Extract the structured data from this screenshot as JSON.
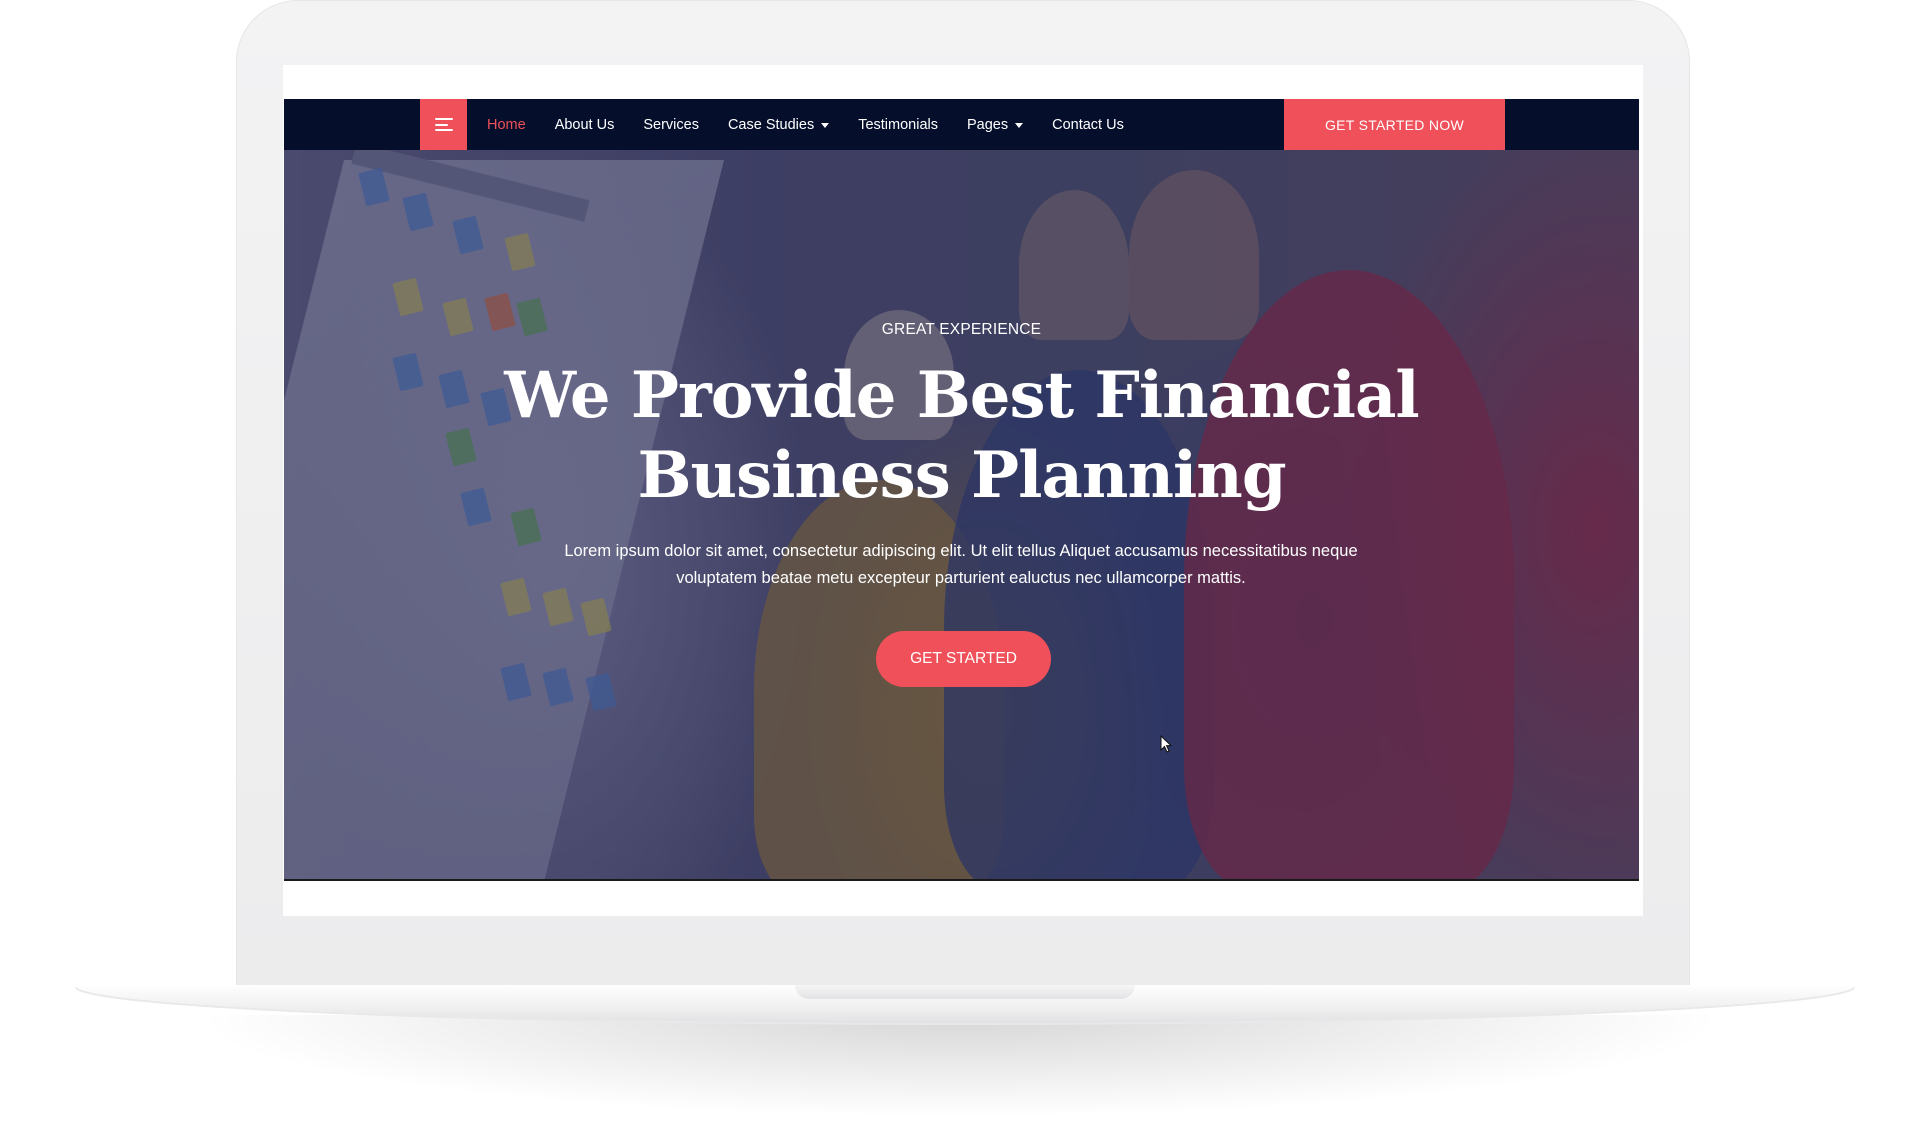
{
  "nav": {
    "menu_icon": "hamburger-icon",
    "items": [
      {
        "label": "Home",
        "active": true
      },
      {
        "label": "About Us"
      },
      {
        "label": "Services"
      },
      {
        "label": "Case Studies",
        "dropdown": true
      },
      {
        "label": "Testimonials"
      },
      {
        "label": "Pages",
        "dropdown": true
      },
      {
        "label": "Contact Us"
      }
    ],
    "cta_label": "GET STARTED NOW"
  },
  "hero": {
    "eyebrow": "GREAT EXPERIENCE",
    "headline_line1": "We Provide Best Financial",
    "headline_line2": "Business Planning",
    "subtext_line1": "Lorem ipsum dolor sit amet, consectetur adipiscing elit. Ut elit tellus Aliquet accusamus necessitatibus neque",
    "subtext_line2": "voluptatem beatae metu excepteur parturient ealuctus nec ullamcorper mattis.",
    "cta_label": "GET STARTED"
  },
  "colors": {
    "accent": "#ef5059",
    "nav_bg": "#050f2c",
    "text_on_dark": "#ffffff"
  }
}
